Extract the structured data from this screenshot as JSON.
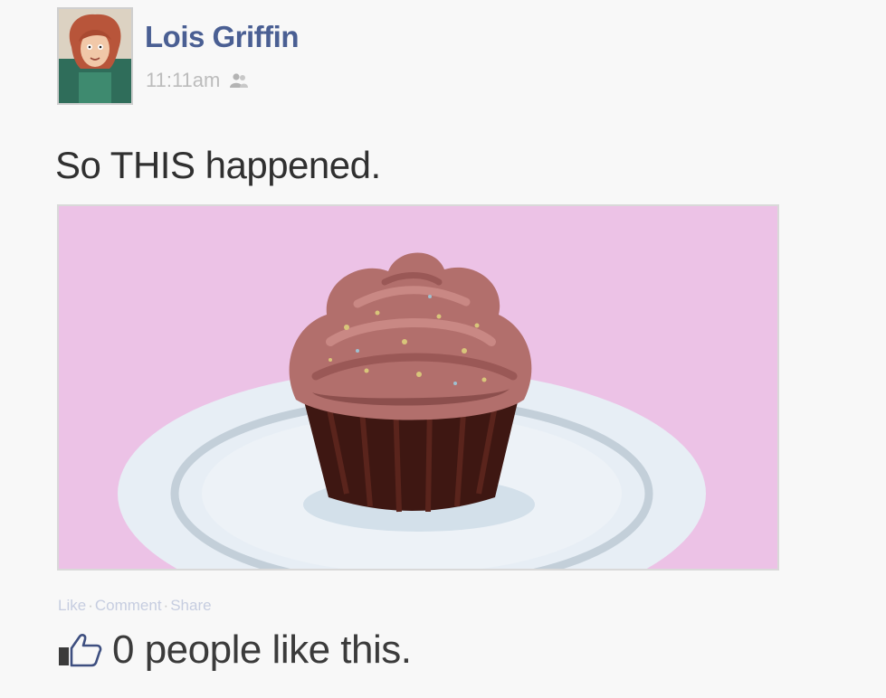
{
  "post": {
    "author": "Lois Griffin",
    "timestamp": "11:11am",
    "text": "So THIS happened.",
    "actions": {
      "like": "Like",
      "comment": "Comment",
      "share": "Share",
      "separator": "·"
    },
    "likes_text": "0 people like this."
  },
  "icons": {
    "audience": "friends-icon",
    "like": "thumbs-up-icon"
  },
  "colors": {
    "author_link": "#4a5f93",
    "photo_background": "#ecc2e6"
  }
}
